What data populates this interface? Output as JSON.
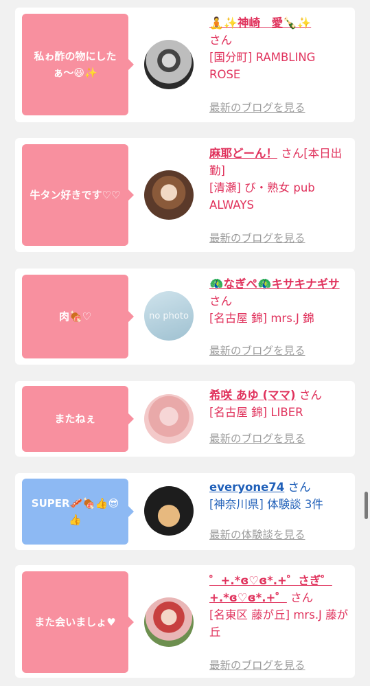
{
  "colors": {
    "accent_pink": "#f8909f",
    "accent_blue": "#8db9f3",
    "name_pink": "#e0325c",
    "name_blue": "#1f5fb8",
    "link_gray": "#9a9a9a"
  },
  "entries": [
    {
      "message": "私ゎ酢の物にしたぁ〜😆✨",
      "username": "🧘✨神崎　愛🍾✨",
      "san": "さん",
      "shop": "[国分町] RAMBLING ROSE",
      "link": "最新のブログを見る"
    },
    {
      "message": "牛タン好きです♡♡",
      "username": "麻耶どーん！",
      "san": "さん[本日出勤]",
      "shop": "[清瀬] び・熟女 pub ALWAYS",
      "link": "最新のブログを見る"
    },
    {
      "message": "肉🍖♡",
      "username": "🦚なぎぺ🦚キサキナギサ",
      "san": "さん",
      "shop": "[名古屋 錦] mrs.J 錦",
      "link": "最新のブログを見る",
      "avatar_text": "no photo"
    },
    {
      "message": "またねぇ",
      "username": "希咲 あゆ (ママ)",
      "san": "さん",
      "shop": "[名古屋 錦] LIBER",
      "link": "最新のブログを見る"
    },
    {
      "message": "SUPER🥓🍖👍😎👍",
      "username": "everyone74",
      "san": "さん",
      "shop": "[神奈川県] 体験談 3件",
      "link": "最新の体験談を見る"
    },
    {
      "message": "また会いましょ♥",
      "username": "゜+.*ɞ♡ɞ*.+゜さぎ゜+.*ɞ♡ɞ*.+゜",
      "san": "さん",
      "shop": "[名東区 藤が丘] mrs.J 藤が丘",
      "link": "最新のブログを見る"
    }
  ]
}
